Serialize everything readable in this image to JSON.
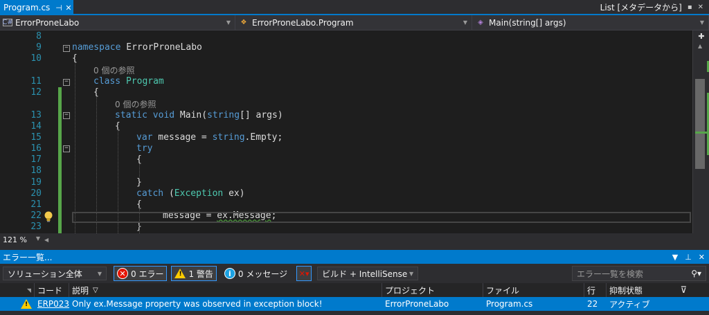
{
  "tab": {
    "title": "Program.cs",
    "pin": "⊣",
    "close": "✕"
  },
  "tabstrip_right": {
    "label": "List [メタデータから]",
    "icons": [
      "lock-icon",
      "close-icon"
    ]
  },
  "nav": {
    "project": "ErrorProneLabo",
    "type": "ErrorProneLabo.Program",
    "member": "Main(string[] args)"
  },
  "editor": {
    "zoom": "121 %",
    "lines": [
      {
        "num": "8",
        "code": []
      },
      {
        "num": "9",
        "code": [
          [
            "kw",
            "namespace"
          ],
          [
            "pl",
            " ErrorProneLabo"
          ]
        ]
      },
      {
        "num": "10",
        "code": [
          [
            "pl",
            "{"
          ]
        ]
      },
      {
        "num": "",
        "code": [
          [
            "ref",
            "0 個の参照"
          ]
        ]
      },
      {
        "num": "11",
        "code": [
          [
            "kw",
            "class"
          ],
          [
            "pl",
            " "
          ],
          [
            "ty",
            "Program"
          ]
        ]
      },
      {
        "num": "12",
        "code": [
          [
            "pl",
            "{"
          ]
        ]
      },
      {
        "num": "",
        "code": [
          [
            "ref",
            "0 個の参照"
          ]
        ]
      },
      {
        "num": "13",
        "code": [
          [
            "kw",
            "static void"
          ],
          [
            "pl",
            " Main("
          ],
          [
            "kw",
            "string"
          ],
          [
            "pl",
            "[] args)"
          ]
        ]
      },
      {
        "num": "14",
        "code": [
          [
            "pl",
            "{"
          ]
        ]
      },
      {
        "num": "15",
        "code": [
          [
            "kw",
            "var"
          ],
          [
            "pl",
            " message = "
          ],
          [
            "kw",
            "string"
          ],
          [
            "pl",
            "."
          ],
          [
            "pl",
            "Empty;"
          ]
        ]
      },
      {
        "num": "16",
        "code": [
          [
            "kw",
            "try"
          ]
        ]
      },
      {
        "num": "17",
        "code": [
          [
            "pl",
            "{"
          ]
        ]
      },
      {
        "num": "18",
        "code": []
      },
      {
        "num": "19",
        "code": [
          [
            "pl",
            "}"
          ]
        ]
      },
      {
        "num": "20",
        "code": [
          [
            "kw",
            "catch"
          ],
          [
            "pl",
            " ("
          ],
          [
            "ty",
            "Exception"
          ],
          [
            "pl",
            " ex)"
          ]
        ]
      },
      {
        "num": "21",
        "code": [
          [
            "pl",
            "{"
          ]
        ]
      },
      {
        "num": "22",
        "code": [
          [
            "pl",
            "message = "
          ],
          [
            "sq",
            "ex.Message"
          ],
          [
            "pl",
            ";"
          ]
        ]
      },
      {
        "num": "23",
        "code": [
          [
            "pl",
            "}"
          ]
        ]
      }
    ]
  },
  "errorlist": {
    "title": "エラー一覧...",
    "scope": "ソリューション全体",
    "errors_label": "0 エラー",
    "warnings_label": "1 警告",
    "messages_label": "0 メッセージ",
    "build_filter": "ビルド + IntelliSense",
    "search_placeholder": "エラー一覧を検索",
    "columns": {
      "code": "コード",
      "description": "説明",
      "project": "プロジェクト",
      "file": "ファイル",
      "line": "行",
      "suppression": "抑制状態"
    },
    "rows": [
      {
        "code": "ERP023",
        "description": "Only ex.Message property was observed in exception block!",
        "project": "ErrorProneLabo",
        "file": "Program.cs",
        "line": "22",
        "suppression": "アクティブ"
      }
    ]
  }
}
